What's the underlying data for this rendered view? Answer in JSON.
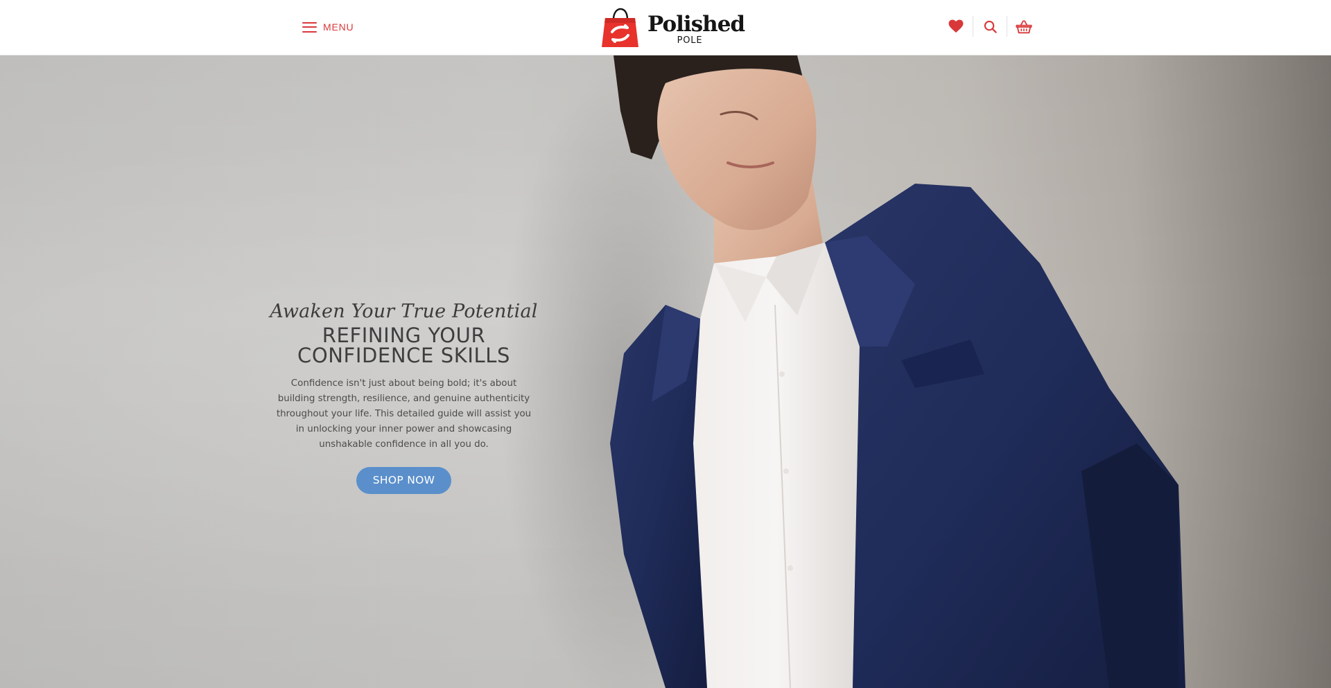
{
  "header": {
    "menu_label": "MENU",
    "logo": {
      "title": "Polished",
      "subtitle": "POLE"
    },
    "icons": [
      "heart-icon",
      "search-icon",
      "basket-icon"
    ]
  },
  "hero": {
    "script_heading": "Awaken Your True Potential",
    "title_line1": "REFINING YOUR",
    "title_line2": "CONFIDENCE SKILLS",
    "description": "Confidence isn't just about being bold; it's about building strength, resilience, and genuine authenticity throughout your life. This detailed guide will assist you in unlocking your inner power and showcasing unshakable confidence in all you do.",
    "cta_label": "SHOP NOW"
  },
  "colors": {
    "accent": "#d9383a",
    "cta": "#5a8fcb",
    "text_dark": "#3e3e3e",
    "suit_navy": "#1e2a55"
  }
}
